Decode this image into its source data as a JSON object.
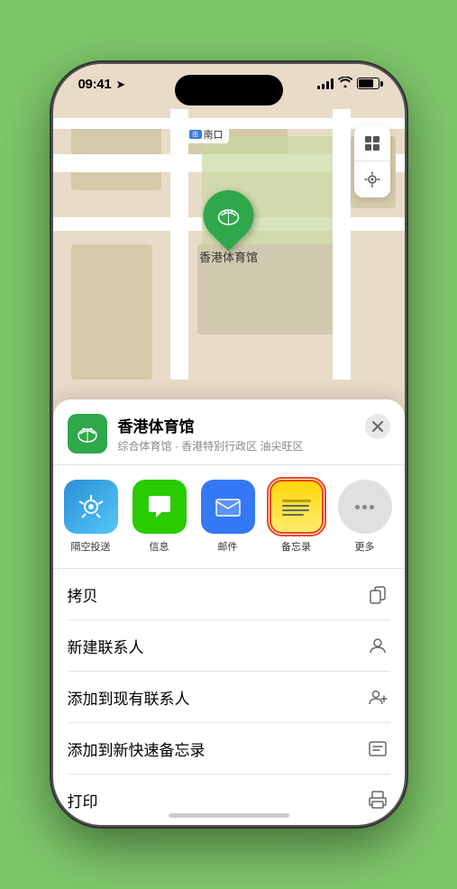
{
  "status_bar": {
    "time": "09:41",
    "location_arrow": "▲"
  },
  "map": {
    "label_text": "南口",
    "venue_name": "香港体育馆"
  },
  "location_card": {
    "name": "香港体育馆",
    "subtitle": "综合体育馆 · 香港特别行政区 油尖旺区",
    "close_label": "×"
  },
  "share_apps": [
    {
      "id": "airdrop",
      "label": "隔空投送"
    },
    {
      "id": "messages",
      "label": "信息"
    },
    {
      "id": "mail",
      "label": "邮件"
    },
    {
      "id": "notes",
      "label": "备忘录",
      "selected": true
    }
  ],
  "actions": [
    {
      "label": "拷贝",
      "icon": "copy"
    },
    {
      "label": "新建联系人",
      "icon": "person"
    },
    {
      "label": "添加到现有联系人",
      "icon": "person-add"
    },
    {
      "label": "添加到新快速备忘录",
      "icon": "quick-note"
    },
    {
      "label": "打印",
      "icon": "print"
    }
  ]
}
